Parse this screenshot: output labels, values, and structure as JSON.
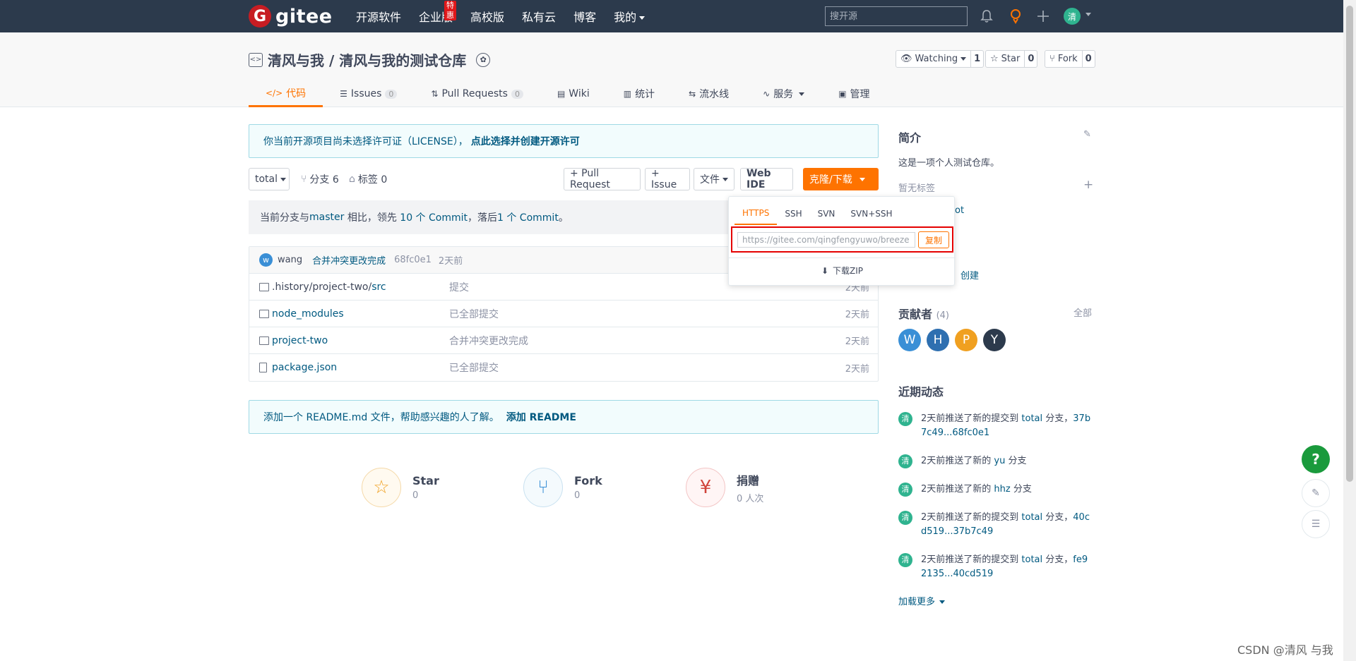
{
  "topnav": {
    "logo_letter": "G",
    "logo_text": "gitee",
    "links": [
      "开源软件",
      "企业版",
      "高校版",
      "私有云",
      "博客",
      "我的"
    ],
    "hot_badge": "特惠",
    "search_placeholder": "搜开源",
    "avatar_letter": "清",
    "icons": [
      "bell-icon",
      "location-pin-icon",
      "plus-icon"
    ]
  },
  "header": {
    "repo_title": "清风与我 / 清风与我的测试仓库",
    "watching_label": "Watching",
    "watching_count": "1",
    "star_label": "Star",
    "star_count": "0",
    "fork_label": "Fork",
    "fork_count": "0"
  },
  "tabs": [
    {
      "label": "代码",
      "count": null
    },
    {
      "label": "Issues",
      "count": "0"
    },
    {
      "label": "Pull Requests",
      "count": "0"
    },
    {
      "label": "Wiki",
      "count": null
    },
    {
      "label": "统计",
      "count": null
    },
    {
      "label": "流水线",
      "count": null
    },
    {
      "label": "服务",
      "count": null
    },
    {
      "label": "管理",
      "count": null
    }
  ],
  "license_notice": {
    "text": "你当前开源项目尚未选择许可证（LICENSE），",
    "link": "点此选择并创建开源许可"
  },
  "toolbar": {
    "branch": "total",
    "branches_label": "分支 6",
    "tags_label": "标签 0",
    "pull_request": "+ Pull Request",
    "issue": "+ Issue",
    "files": "文件",
    "web_ide": "Web IDE",
    "clone": "克隆/下载"
  },
  "compare": {
    "p1": "当前分支与 ",
    "branch": "master",
    "p2": " 相比，领先 ",
    "ahead": "10 个 Commit",
    "p3": "，落后 ",
    "behind": "1 个 Commit",
    "p4": "。"
  },
  "commit": {
    "avatar": "w",
    "author": "wang",
    "message": "合并冲突更改完成",
    "hash": "68fc0e1",
    "time": "2天前"
  },
  "files": [
    {
      "prefix": ".history/project-two/",
      "name": "src",
      "message": "提交",
      "time": "2天前",
      "type": "folder"
    },
    {
      "prefix": "",
      "name": "node_modules",
      "message": "已全部提交",
      "time": "2天前",
      "type": "folder"
    },
    {
      "prefix": "",
      "name": "project-two",
      "message": "合并冲突更改完成",
      "time": "2天前",
      "type": "folder"
    },
    {
      "prefix": "",
      "name": "package.json",
      "message": "已全部提交",
      "time": "2天前",
      "type": "file"
    }
  ],
  "readme_notice": {
    "text": "添加一个 README.md 文件，帮助感兴趣的人了解。",
    "link": "添加 README"
  },
  "stats": [
    {
      "label": "Star",
      "value": "0"
    },
    {
      "label": "Fork",
      "value": "0"
    },
    {
      "label": "捐赠",
      "value": "0 人次"
    }
  ],
  "clone_popup": {
    "tabs": [
      "HTTPS",
      "SSH",
      "SVN",
      "SVN+SSH"
    ],
    "url": "https://gitee.com/qingfengyuwo/breeze",
    "copy": "复制",
    "download": "下载ZIP"
  },
  "sidebar": {
    "intro_title": "简介",
    "intro_text": "这是一项个人测试仓库。",
    "no_tags": "暂无标签",
    "hidden_fragment": "ot",
    "created": "创建",
    "contributors_title": "贡献者",
    "contributors_count": "(4)",
    "contributors_all": "全部",
    "contributors": [
      {
        "letter": "W",
        "color": "#3a8fd6"
      },
      {
        "letter": "H",
        "color": "#2e6fb0"
      },
      {
        "letter": "P",
        "color": "#f0a020"
      },
      {
        "letter": "Y",
        "color": "#2c3a4c"
      }
    ],
    "activity_title": "近期动态",
    "activities": [
      {
        "pre": "2天前推送了新的提交到 ",
        "branch": "total",
        "mid": " 分支，",
        "tail": "37b7c49...68fc0e1"
      },
      {
        "pre": "2天前推送了新的 ",
        "branch": "yu",
        "mid": " 分支",
        "tail": ""
      },
      {
        "pre": "2天前推送了新的 ",
        "branch": "hhz",
        "mid": " 分支",
        "tail": ""
      },
      {
        "pre": "2天前推送了新的提交到 ",
        "branch": "total",
        "mid": " 分支，",
        "tail": "40cd519...37b7c49"
      },
      {
        "pre": "2天前推送了新的提交到 ",
        "branch": "total",
        "mid": " 分支，",
        "tail": "fe92135...40cd519"
      }
    ],
    "activity_avatar": "清",
    "load_more": "加载更多"
  },
  "float_buttons": {
    "help": "?"
  },
  "watermark": "CSDN @清风 与我",
  "colors": {
    "accent": "#fe7300",
    "nav_bg": "#2c3a4c",
    "link": "#005980",
    "help_green": "#1a9a3c"
  }
}
